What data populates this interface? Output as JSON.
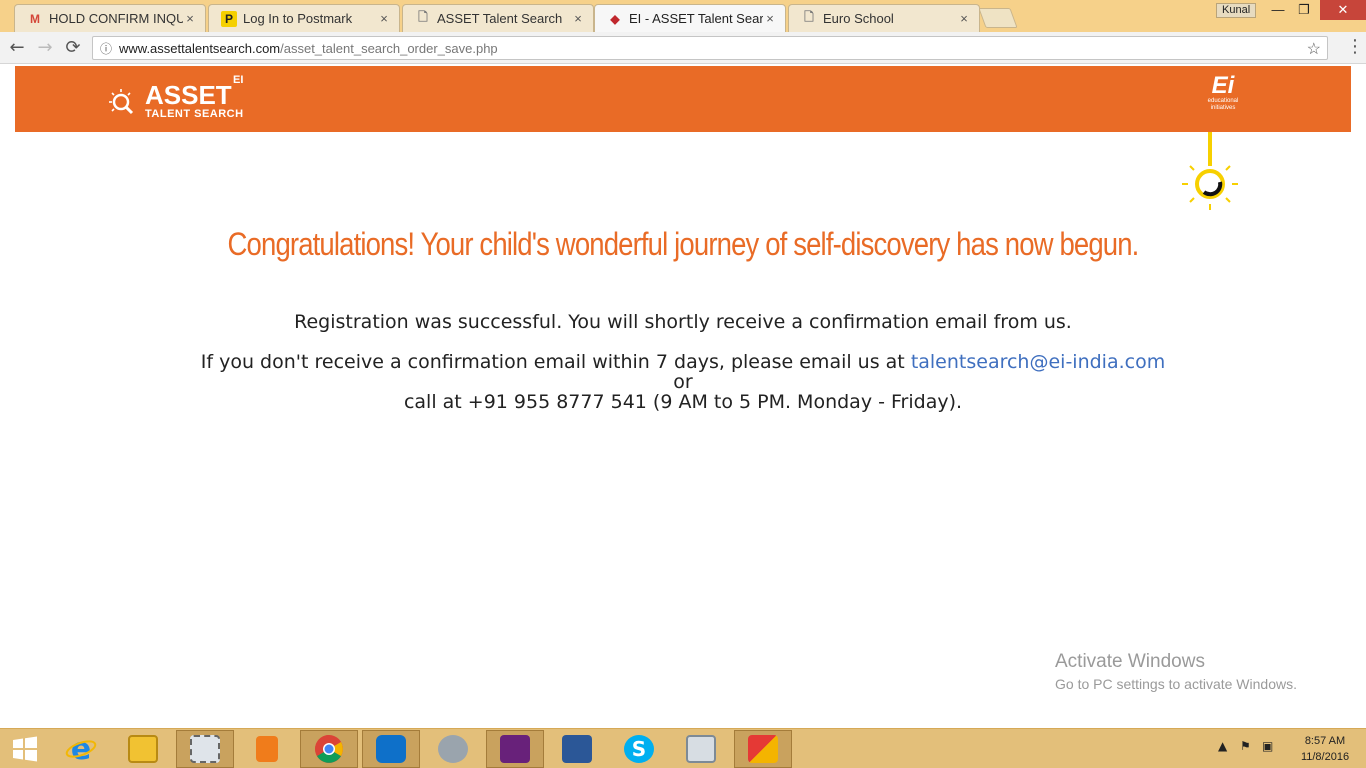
{
  "browser": {
    "tabs": [
      {
        "label": "HOLD CONFIRM INQUIR",
        "icon": "gmail-icon",
        "icon_text": "M"
      },
      {
        "label": "Log In to Postmark",
        "icon": "postmark-icon",
        "icon_text": "P"
      },
      {
        "label": "ASSET Talent Search",
        "icon": "page-icon",
        "icon_text": "🗋"
      },
      {
        "label": "EI - ASSET Talent Search",
        "icon": "ei-favicon-icon",
        "icon_text": "◆"
      },
      {
        "label": "Euro School",
        "icon": "page-icon",
        "icon_text": "🗋"
      }
    ],
    "tab_close": "×",
    "user_name": "Kunal",
    "window_buttons": {
      "minimize": "—",
      "maximize": "❐",
      "close": "✕"
    },
    "nav": {
      "back": "←",
      "forward": "→",
      "reload": "⟳"
    },
    "url_host": "www.assettalentsearch.com",
    "url_path": "/asset_talent_search_order_save.php",
    "star": "☆",
    "menu": "⋮"
  },
  "page": {
    "logo_brand": "ASSET",
    "logo_ei": "EI",
    "logo_sub": "TALENT SEARCH",
    "ei_logo_big": "Ei",
    "ei_logo_line1": "educational",
    "ei_logo_line2": "initiatives",
    "headline": "Congratulations! Your child's wonderful journey of self-discovery has now begun.",
    "line1": "Registration was successful. You will shortly receive a confirmation email from us.",
    "line2_prefix": "If you don't receive a confirmation email within 7 days, please email us at ",
    "email": "talentsearch@ei-india.com",
    "line3": "or",
    "line4": "call at +91 955 8777 541 (9 AM to 5 PM. Monday - Friday).",
    "header_color": "#e96b26"
  },
  "watermark": {
    "title": "Activate Windows",
    "subtitle": "Go to PC settings to activate Windows."
  },
  "taskbar": {
    "apps": [
      "start-button",
      "internet-explorer-icon",
      "file-explorer-icon",
      "snipping-tool-icon",
      "media-player-icon",
      "chrome-icon",
      "teamviewer-icon",
      "speaker-app-icon",
      "visual-studio-icon",
      "remote-desktop-icon",
      "skype-icon",
      "performance-monitor-icon",
      "paint-icon"
    ],
    "time": "8:57 AM",
    "date": "11/8/2016"
  }
}
